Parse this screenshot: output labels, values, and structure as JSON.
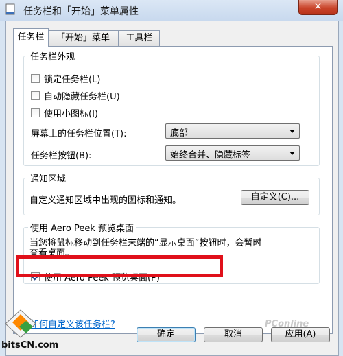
{
  "window": {
    "title": "任务栏和「开始」菜单属性",
    "close_label": "✕"
  },
  "tabs": [
    {
      "label": "任务栏",
      "active": true
    },
    {
      "label": "「开始」菜单",
      "active": false
    },
    {
      "label": "工具栏",
      "active": false
    }
  ],
  "appearance": {
    "title": "任务栏外观",
    "lock": {
      "label": "锁定任务栏(L)",
      "checked": false
    },
    "autohide": {
      "label": "自动隐藏任务栏(U)",
      "checked": false
    },
    "small_icons": {
      "label": "使用小图标(I)",
      "checked": false
    },
    "location_label": "屏幕上的任务栏位置(T):",
    "location_value": "底部",
    "buttons_label": "任务栏按钮(B):",
    "buttons_value": "始终合并、隐藏标签"
  },
  "notification": {
    "title": "通知区域",
    "description": "自定义通知区域中出现的图标和通知。",
    "customize_button": "自定义(C)..."
  },
  "aero": {
    "title": "使用 Aero Peek 预览桌面",
    "description_line1": "当您将鼠标移动到任务栏末端的“显示桌面”按钮时，会暂时",
    "description_line2": "查看桌面。",
    "checkbox": {
      "label": "使用 Aero Peek 预览桌面(P)",
      "checked": true
    }
  },
  "help_link": "如何自定义该任务栏?",
  "footer": {
    "ok": "确定",
    "cancel": "取消",
    "apply": "应用(A)"
  },
  "watermarks": {
    "site": "bitsCN.com",
    "corner": "PConline"
  },
  "colors": {
    "highlight_box": "#e0101a",
    "link": "#0066cc",
    "close_button": "#c9442a"
  }
}
